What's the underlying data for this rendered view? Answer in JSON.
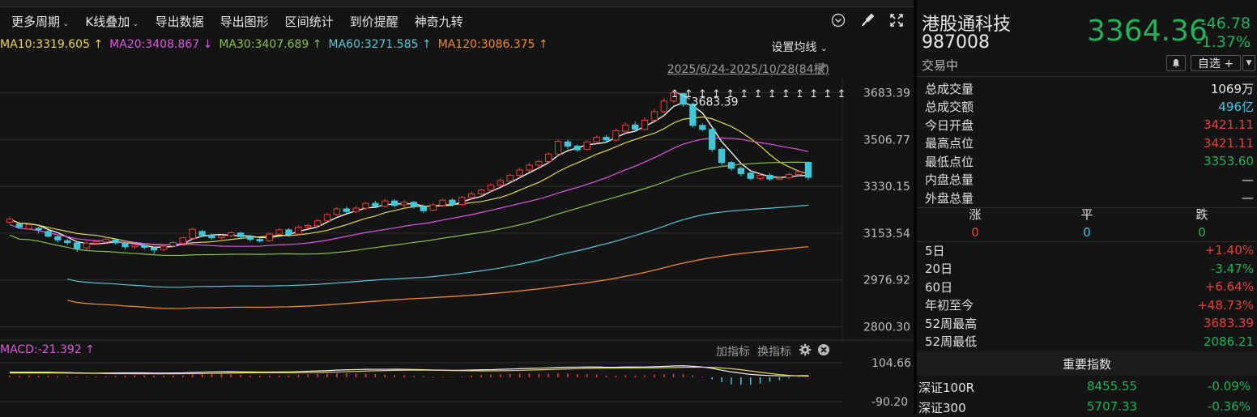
{
  "toolbar": {
    "items": [
      {
        "label": "更多周期",
        "caret": "⌄"
      },
      {
        "label": "K线叠加",
        "caret": "⌄"
      },
      {
        "label": "导出数据",
        "caret": ""
      },
      {
        "label": "导出图形",
        "caret": ""
      },
      {
        "label": "区间统计",
        "caret": ""
      },
      {
        "label": "到价提醒",
        "caret": ""
      },
      {
        "label": "神奇九转",
        "caret": ""
      }
    ]
  },
  "ma": {
    "items": [
      {
        "text": "MA10:3319.605 ↑",
        "color": "#e8d84a"
      },
      {
        "text": "MA20:3408.867 ↓",
        "color": "#e055e0"
      },
      {
        "text": "MA30:3407.689 ↑",
        "color": "#8ac04a"
      },
      {
        "text": "MA60:3271.585 ↑",
        "color": "#58c8d8"
      },
      {
        "text": "MA120:3086.375 ↑",
        "color": "#f08a30"
      }
    ],
    "settings_label": "设置均线",
    "settings_caret": "⌄"
  },
  "range_label": "2025/6/24-2025/10/28(84根)",
  "chart_data": {
    "type": "candlestick",
    "ylim": [
      2750,
      3740
    ],
    "yticks": [
      3683.39,
      3506.77,
      3330.15,
      3153.54,
      2976.92,
      2800.3
    ],
    "high_marker": "3683.39",
    "candles": [
      [
        3195,
        3206,
        3216,
        3190
      ],
      [
        3188,
        3176,
        3196,
        3170
      ],
      [
        3170,
        3185,
        3192,
        3165
      ],
      [
        3172,
        3166,
        3178,
        3152
      ],
      [
        3160,
        3142,
        3165,
        3138
      ],
      [
        3140,
        3128,
        3146,
        3118
      ],
      [
        3125,
        3118,
        3132,
        3108
      ],
      [
        3117,
        3096,
        3122,
        3082
      ],
      [
        3098,
        3116,
        3125,
        3090
      ],
      [
        3115,
        3122,
        3128,
        3108
      ],
      [
        3120,
        3130,
        3135,
        3115
      ],
      [
        3128,
        3117,
        3133,
        3110
      ],
      [
        3116,
        3102,
        3120,
        3092
      ],
      [
        3102,
        3110,
        3116,
        3095
      ],
      [
        3108,
        3100,
        3112,
        3092
      ],
      [
        3098,
        3090,
        3102,
        3075
      ],
      [
        3092,
        3104,
        3110,
        3086
      ],
      [
        3105,
        3118,
        3124,
        3100
      ],
      [
        3115,
        3136,
        3140,
        3110
      ],
      [
        3134,
        3168,
        3175,
        3128
      ],
      [
        3160,
        3146,
        3166,
        3140
      ],
      [
        3146,
        3136,
        3152,
        3128
      ],
      [
        3136,
        3144,
        3150,
        3130
      ],
      [
        3144,
        3155,
        3160,
        3138
      ],
      [
        3154,
        3140,
        3158,
        3130
      ],
      [
        3140,
        3130,
        3146,
        3122
      ],
      [
        3130,
        3124,
        3136,
        3118
      ],
      [
        3125,
        3150,
        3156,
        3120
      ],
      [
        3150,
        3166,
        3172,
        3146
      ],
      [
        3166,
        3150,
        3172,
        3140
      ],
      [
        3150,
        3176,
        3184,
        3146
      ],
      [
        3176,
        3182,
        3188,
        3170
      ],
      [
        3182,
        3200,
        3206,
        3175
      ],
      [
        3200,
        3224,
        3230,
        3195
      ],
      [
        3224,
        3245,
        3252,
        3218
      ],
      [
        3245,
        3235,
        3254,
        3226
      ],
      [
        3235,
        3248,
        3256,
        3228
      ],
      [
        3248,
        3266,
        3272,
        3240
      ],
      [
        3266,
        3255,
        3276,
        3248
      ],
      [
        3255,
        3275,
        3283,
        3250
      ],
      [
        3275,
        3258,
        3282,
        3250
      ],
      [
        3260,
        3270,
        3278,
        3252
      ],
      [
        3270,
        3254,
        3276,
        3246
      ],
      [
        3254,
        3238,
        3262,
        3230
      ],
      [
        3240,
        3260,
        3268,
        3236
      ],
      [
        3258,
        3278,
        3284,
        3252
      ],
      [
        3278,
        3262,
        3286,
        3254
      ],
      [
        3262,
        3288,
        3294,
        3256
      ],
      [
        3288,
        3302,
        3310,
        3280
      ],
      [
        3302,
        3316,
        3322,
        3296
      ],
      [
        3316,
        3335,
        3342,
        3308
      ],
      [
        3335,
        3352,
        3360,
        3328
      ],
      [
        3350,
        3372,
        3378,
        3344
      ],
      [
        3372,
        3392,
        3400,
        3365
      ],
      [
        3392,
        3410,
        3418,
        3385
      ],
      [
        3410,
        3424,
        3430,
        3402
      ],
      [
        3424,
        3452,
        3458,
        3418
      ],
      [
        3452,
        3500,
        3506,
        3446
      ],
      [
        3498,
        3482,
        3506,
        3470
      ],
      [
        3482,
        3468,
        3488,
        3460
      ],
      [
        3470,
        3498,
        3504,
        3466
      ],
      [
        3498,
        3515,
        3522,
        3492
      ],
      [
        3515,
        3505,
        3525,
        3498
      ],
      [
        3505,
        3540,
        3548,
        3500
      ],
      [
        3538,
        3562,
        3572,
        3530
      ],
      [
        3562,
        3545,
        3575,
        3538
      ],
      [
        3545,
        3580,
        3590,
        3540
      ],
      [
        3580,
        3612,
        3622,
        3575
      ],
      [
        3612,
        3652,
        3662,
        3605
      ],
      [
        3652,
        3683,
        3690,
        3645
      ],
      [
        3680,
        3640,
        3684,
        3630
      ],
      [
        3640,
        3560,
        3646,
        3552
      ],
      [
        3560,
        3545,
        3568,
        3538
      ],
      [
        3545,
        3470,
        3552,
        3460
      ],
      [
        3470,
        3420,
        3478,
        3410
      ],
      [
        3420,
        3398,
        3426,
        3388
      ],
      [
        3398,
        3378,
        3405,
        3368
      ],
      [
        3380,
        3360,
        3388,
        3352
      ],
      [
        3360,
        3372,
        3380,
        3352
      ],
      [
        3372,
        3358,
        3380,
        3350
      ],
      [
        3358,
        3362,
        3368,
        3354
      ],
      [
        3362,
        3375,
        3382,
        3356
      ],
      [
        3375,
        3385,
        3392,
        3368
      ],
      [
        3421,
        3364,
        3421,
        3354
      ]
    ],
    "macd_label": "MACD:-21.392 ↑",
    "macd_ticks": [
      "104.66",
      "-90.20"
    ]
  },
  "indicator": {
    "add": "加指标",
    "switch": "换指标"
  },
  "quote": {
    "name": "港股通科技",
    "code": "987008",
    "status": "交易中",
    "price": "3364.36",
    "change": "-46.78",
    "pct": "-1.37%",
    "fav": "自选 +",
    "stats": [
      {
        "label": "总成交量",
        "value": "1069万",
        "color": "#e6e6e6"
      },
      {
        "label": "总成交额",
        "value": "496亿",
        "color": "#42c6e8"
      },
      {
        "label": "今日开盘",
        "value": "3421.11",
        "color": "#e8403c"
      },
      {
        "label": "最高点位",
        "value": "3421.11",
        "color": "#e8403c"
      },
      {
        "label": "最低点位",
        "value": "3353.60",
        "color": "#1fb35a"
      },
      {
        "label": "内盘总量",
        "value": "—",
        "color": "#e6e6e6"
      },
      {
        "label": "外盘总量",
        "value": "—",
        "color": "#e6e6e6"
      }
    ],
    "updown": {
      "up_label": "涨",
      "flat_label": "平",
      "down_label": "跌",
      "up": "0",
      "flat": "0",
      "down": "0"
    },
    "periods": [
      {
        "label": "5日",
        "value": "+1.40%",
        "color": "#e8403c"
      },
      {
        "label": "20日",
        "value": "-3.47%",
        "color": "#1fb35a"
      },
      {
        "label": "60日",
        "value": "+6.64%",
        "color": "#e8403c"
      },
      {
        "label": "年初至今",
        "value": "+48.73%",
        "color": "#e8403c"
      },
      {
        "label": "52周最高",
        "value": "3683.39",
        "color": "#e8403c"
      },
      {
        "label": "52周最低",
        "value": "2086.21",
        "color": "#1fb35a"
      }
    ],
    "index_header": "重要指数",
    "indices": [
      {
        "name": "深证100R",
        "price": "8455.55",
        "pct": "-0.09%"
      },
      {
        "name": "深证300",
        "price": "5707.33",
        "pct": "-0.36%"
      }
    ]
  }
}
